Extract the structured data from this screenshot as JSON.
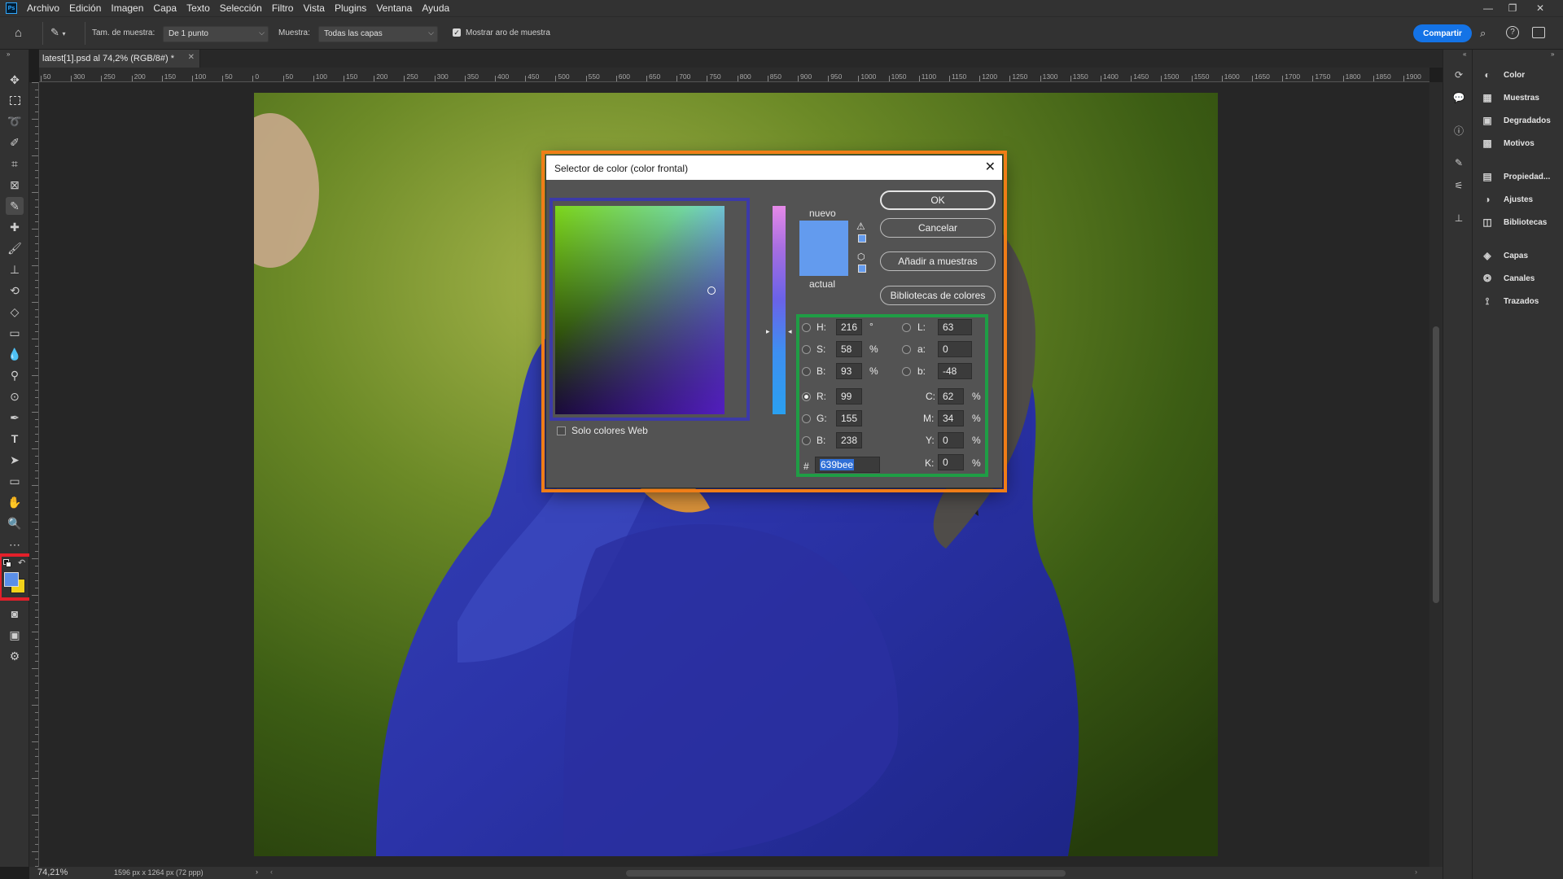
{
  "app": {
    "logo": "Ps",
    "menu": [
      "Archivo",
      "Edición",
      "Imagen",
      "Capa",
      "Texto",
      "Selección",
      "Filtro",
      "Vista",
      "Plugins",
      "Ventana",
      "Ayuda"
    ]
  },
  "options": {
    "sample_size_label": "Tam. de muestra:",
    "sample_size_value": "De 1 punto",
    "sample_label": "Muestra:",
    "sample_value": "Todas las capas",
    "show_ring_label": "Mostrar aro de muestra",
    "show_ring_checked": true,
    "share_label": "Compartir"
  },
  "document": {
    "tab_title": "latest[1].psd al 74,2% (RGB/8#) *",
    "zoom": "74,21%",
    "dimensions": "1596 px x 1264 px (72 ppp)"
  },
  "ruler": {
    "h_ticks": [
      "50",
      "300",
      "250",
      "200",
      "150",
      "100",
      "50",
      "0",
      "50",
      "100",
      "150",
      "200",
      "250",
      "300",
      "350",
      "400",
      "450",
      "500",
      "550",
      "600",
      "650",
      "700",
      "750",
      "800",
      "850",
      "900",
      "950",
      "1000",
      "1050",
      "1100",
      "1150",
      "1200",
      "1250",
      "1300",
      "1350",
      "1400",
      "1450",
      "1500",
      "1550",
      "1600",
      "1650",
      "1700",
      "1750",
      "1800",
      "1850",
      "1900"
    ]
  },
  "panels": {
    "items": [
      {
        "label": "Color",
        "icon": "color-icon"
      },
      {
        "label": "Muestras",
        "icon": "swatches-icon"
      },
      {
        "label": "Degradados",
        "icon": "gradients-icon"
      },
      {
        "label": "Motivos",
        "icon": "patterns-icon"
      },
      {
        "label": "Propiedad...",
        "icon": "properties-icon"
      },
      {
        "label": "Ajustes",
        "icon": "adjustments-icon"
      },
      {
        "label": "Bibliotecas",
        "icon": "libraries-icon"
      },
      {
        "label": "Capas",
        "icon": "layers-icon"
      },
      {
        "label": "Canales",
        "icon": "channels-icon"
      },
      {
        "label": "Trazados",
        "icon": "paths-icon"
      }
    ]
  },
  "dialog": {
    "title": "Selector de color (color frontal)",
    "new_label": "nuevo",
    "current_label": "actual",
    "web_only_label": "Solo colores Web",
    "buttons": {
      "ok": "OK",
      "cancel": "Cancelar",
      "add_swatches": "Añadir a muestras",
      "libraries": "Bibliotecas de colores"
    },
    "hsb": {
      "h_label": "H:",
      "h": "216",
      "h_unit": "°",
      "s_label": "S:",
      "s": "58",
      "s_unit": "%",
      "b_label": "B:",
      "b": "93",
      "b_unit": "%"
    },
    "rgb": {
      "r_label": "R:",
      "r": "99",
      "g_label": "G:",
      "g": "155",
      "b_label": "B:",
      "b": "238"
    },
    "lab": {
      "l_label": "L:",
      "l": "63",
      "a_label": "a:",
      "a": "0",
      "b_label": "b:",
      "b": "-48"
    },
    "cmyk": {
      "c_label": "C:",
      "c": "62",
      "m_label": "M:",
      "m": "34",
      "y_label": "Y:",
      "y": "0",
      "k_label": "K:",
      "k": "0",
      "unit": "%"
    },
    "hex_label": "#",
    "hex": "639bee",
    "new_color": "#639bee",
    "current_color": "#639bee"
  },
  "colors": {
    "foreground": "#5b8fe8",
    "background": "#f2d21a",
    "accent": "#1473e6",
    "highlight_orange": "#f07d17",
    "highlight_blue": "#3c3aa8",
    "highlight_green": "#1f9d45",
    "highlight_red": "#e3202a"
  }
}
